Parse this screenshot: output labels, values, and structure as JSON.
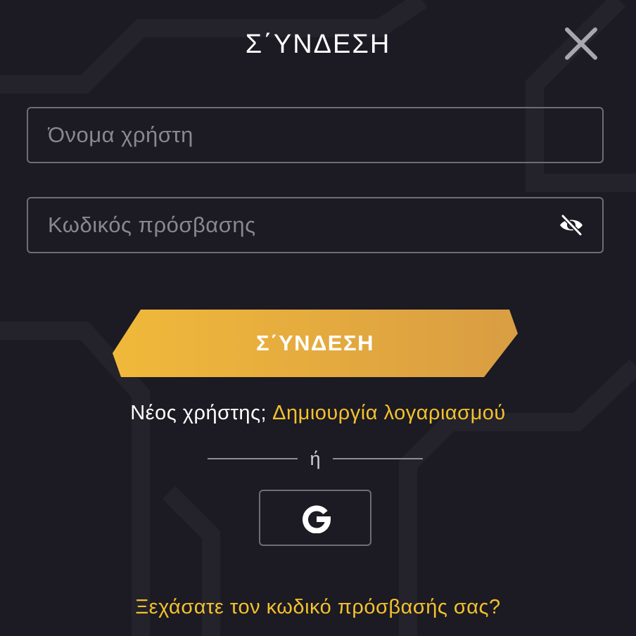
{
  "dialog": {
    "title": "Σ΄ΥΝΔΕΣΗ"
  },
  "form": {
    "username": {
      "value": "",
      "placeholder": "Όνομα χρήστη"
    },
    "password": {
      "value": "",
      "placeholder": "Κωδικός πρόσβασης"
    },
    "login_label": "Σ΄ΥΝΔΕΣΗ"
  },
  "signup": {
    "prefix": "Νέος χρήστης;",
    "link": "Δημιουργία λογαριασμού"
  },
  "divider": {
    "text": "ή"
  },
  "forgot": {
    "link": "Ξεχάσατε τον κωδικό πρόσβασής σας?"
  },
  "icons": {
    "close": "close-icon",
    "eye": "eye-slash-icon",
    "google": "google-icon"
  },
  "colors": {
    "background": "#1c1a22",
    "accent": "#f2c12e",
    "button_gradient_start": "#f0b93a",
    "button_gradient_end": "#d99d43",
    "border": "#6f6c75"
  }
}
